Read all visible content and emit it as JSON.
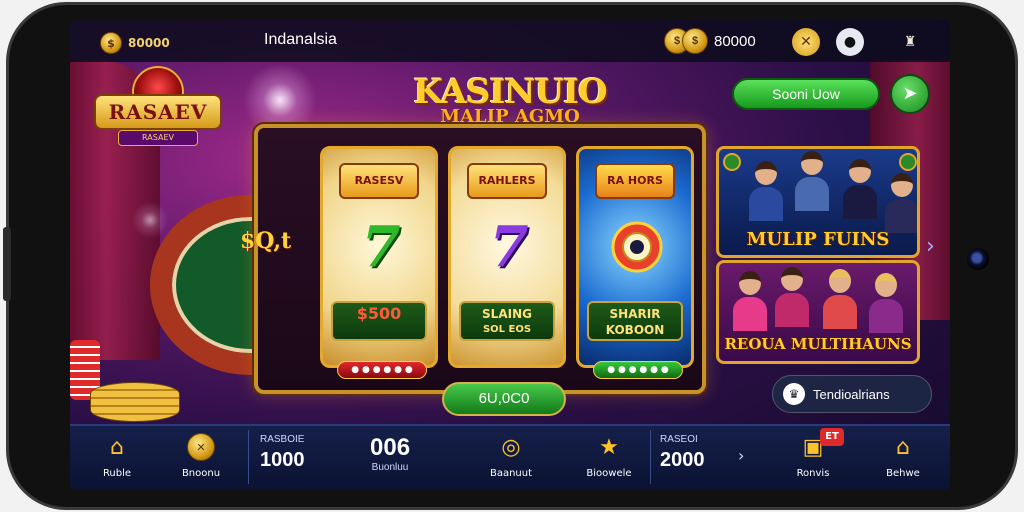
{
  "topbar": {
    "coins_left": "80000",
    "title": "Indanalsia",
    "balance": "80000"
  },
  "logo": {
    "text": "RASAEV",
    "sub": "RASAEV"
  },
  "headline": {
    "line1": "KASINUIO",
    "line2": "MALIP AGMO"
  },
  "social_button": "Sooni Uow",
  "slot": {
    "bet_text": "$Q,t",
    "reels": [
      {
        "title": "RASESV",
        "symbol": "7",
        "label_line1": "$500",
        "label_line2": "",
        "pill": ""
      },
      {
        "title": "RAHLERS",
        "symbol": "7",
        "label_line1": "SLAING",
        "label_line2": "SOL EOS",
        "pill": ""
      },
      {
        "title": "RA HORS",
        "symbol": "",
        "label_line1": "SHARIR",
        "label_line2": "KOBOON",
        "pill": ""
      }
    ],
    "spin_label": "6U,0C0"
  },
  "promos": [
    {
      "text": "MULIP FUINS"
    },
    {
      "text": "REOUA MULTIHAUNS"
    }
  ],
  "right_bubble": "Tendioalrians",
  "bottom_nav": {
    "items": [
      {
        "label": "Ruble",
        "icon": "home-icon"
      },
      {
        "label": "Bnoonu",
        "icon": "coin-icon"
      },
      {
        "label": "Baanuut",
        "icon": "target-icon"
      },
      {
        "label": "Bioowele",
        "icon": "star-icon"
      },
      {
        "label": "Ronvis",
        "icon": "gift-icon"
      },
      {
        "label": "Behwe",
        "icon": "mortarboard-icon"
      }
    ],
    "stats": [
      {
        "label": "RASBOIE",
        "value": "1000"
      },
      {
        "label": "Buonluu",
        "value": "006"
      },
      {
        "label": "RASEOI",
        "value": "2000"
      }
    ],
    "badge": "ET"
  }
}
